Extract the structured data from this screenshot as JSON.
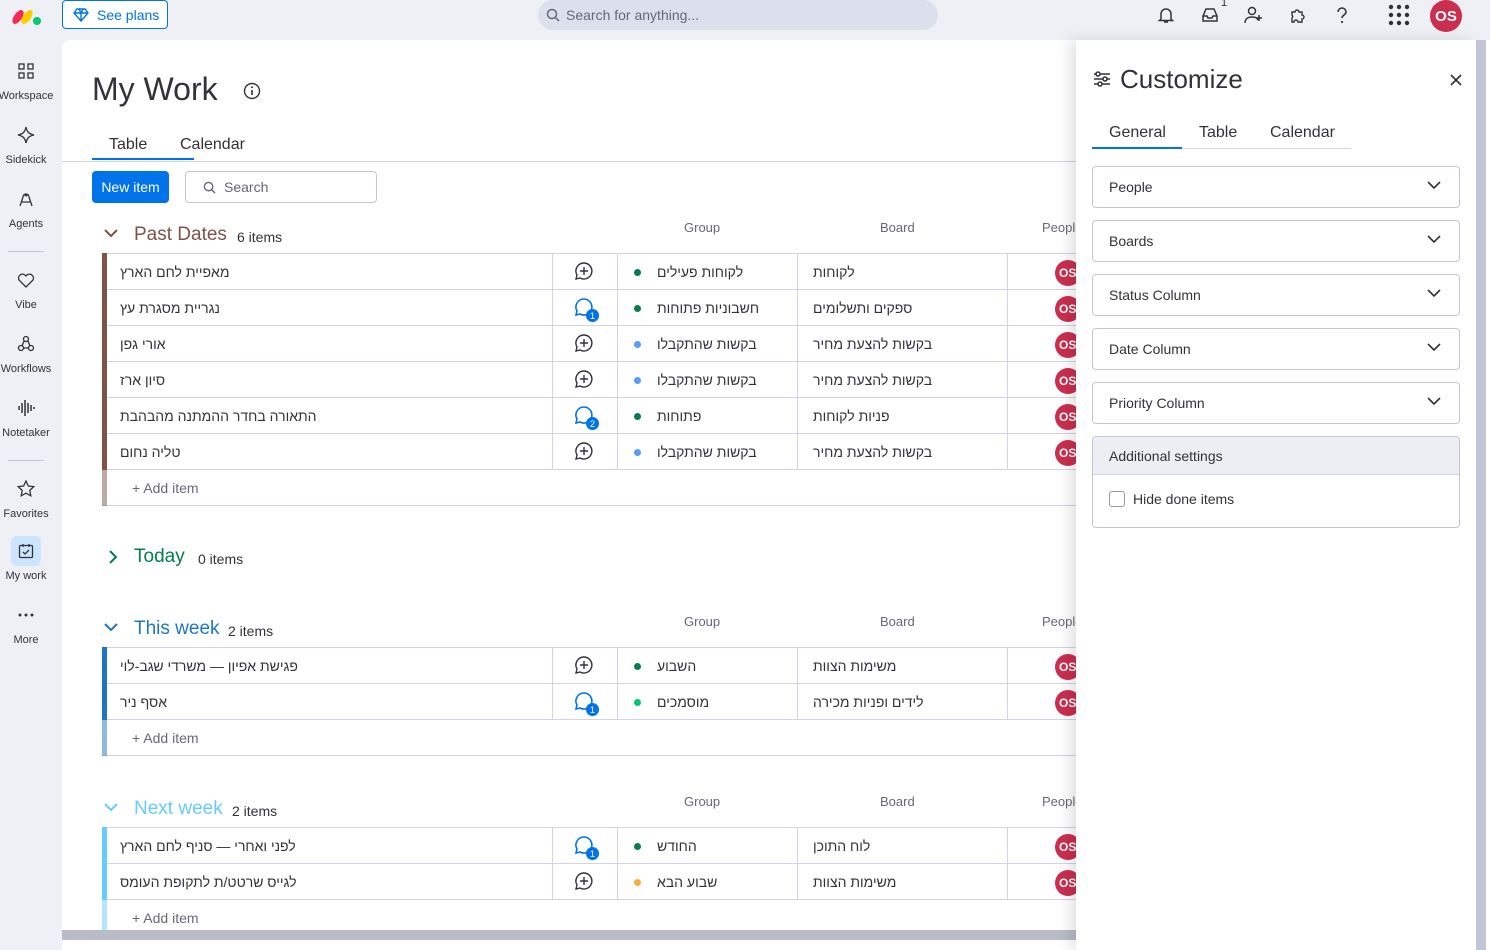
{
  "topbar": {
    "see_plans": "See plans",
    "search_placeholder": "Search for anything...",
    "inbox_count": "1",
    "avatar_initials": "OS"
  },
  "rail": {
    "items": [
      {
        "label": "Workspace",
        "icon": "grid-icon"
      },
      {
        "label": "Sidekick",
        "icon": "sparkle-icon"
      },
      {
        "label": "Agents",
        "icon": "agent-icon"
      },
      {
        "label": "Vibe",
        "icon": "heart-icon"
      },
      {
        "label": "Workflows",
        "icon": "workflow-icon"
      },
      {
        "label": "Notetaker",
        "icon": "waveform-icon"
      },
      {
        "label": "Favorites",
        "icon": "star-icon"
      },
      {
        "label": "My work",
        "icon": "calendar-check-icon"
      },
      {
        "label": "More",
        "icon": "dots-icon"
      }
    ]
  },
  "page": {
    "title": "My Work",
    "tabs": [
      "Table",
      "Calendar"
    ],
    "new_item": "New item",
    "search_placeholder": "Search"
  },
  "columns": {
    "group": "Group",
    "board": "Board",
    "people": "People"
  },
  "groups": [
    {
      "title": "Past Dates",
      "count": "6 items",
      "color": "#7f5347",
      "add_item": "+ Add item",
      "rows": [
        {
          "name": "מאפיית לחם הארץ",
          "group": "לקוחות פעילים",
          "board": "לקוחות",
          "dot": "#037f4c",
          "updates": ""
        },
        {
          "name": "נגריית מסגרת עץ",
          "group": "חשבוניות פתוחות",
          "board": "ספקים ותשלומים",
          "dot": "#037f4c",
          "updates": "1"
        },
        {
          "name": "אורי גפן",
          "group": "בקשות שהתקבלו",
          "board": "בקשות להצעת מחיר",
          "dot": "#579bfc",
          "updates": ""
        },
        {
          "name": "סיון ארז",
          "group": "בקשות שהתקבלו",
          "board": "בקשות להצעת מחיר",
          "dot": "#579bfc",
          "updates": ""
        },
        {
          "name": "התאורה בחדר ההמתנה מהבהבת",
          "group": "פתוחות",
          "board": "פניות לקוחות",
          "dot": "#037f4c",
          "updates": "2"
        },
        {
          "name": "טליה נחום",
          "group": "בקשות שהתקבלו",
          "board": "בקשות להצעת מחיר",
          "dot": "#579bfc",
          "updates": ""
        }
      ]
    },
    {
      "title": "Today",
      "count": "0 items",
      "color": "#037f4c",
      "collapsed": true,
      "rows": []
    },
    {
      "title": "This week",
      "count": "2 items",
      "color": "#1f76c2",
      "add_item": "+ Add item",
      "rows": [
        {
          "name": "פגישת אפיון — משרדי שגב-לוי",
          "group": "השבוע",
          "board": "משימות הצוות",
          "dot": "#037f4c",
          "updates": ""
        },
        {
          "name": "אסף ניר",
          "group": "מוסמכים",
          "board": "לידים ופניות מכירה",
          "dot": "#00c875",
          "updates": "1"
        }
      ]
    },
    {
      "title": "Next week",
      "count": "2 items",
      "color": "#66ccff",
      "add_item": "+ Add item",
      "rows": [
        {
          "name": "לפני ואחרי — סניף לחם הארץ",
          "group": "החודש",
          "board": "לוח התוכן",
          "dot": "#037f4c",
          "updates": "1"
        },
        {
          "name": "לגייס שרטט/ת לתקופת העומס",
          "group": "שבוע הבא",
          "board": "משימות הצוות",
          "dot": "#fdab3d",
          "updates": ""
        }
      ]
    }
  ],
  "row_avatar": "OS",
  "drawer": {
    "title": "Customize",
    "tabs": [
      "General",
      "Table",
      "Calendar"
    ],
    "dropdowns": [
      "People",
      "Boards",
      "Status Column",
      "Date Column",
      "Priority Column"
    ],
    "additional_settings": "Additional settings",
    "hide_done": "Hide done items"
  },
  "colors": {
    "accent": "#0073ea",
    "avatar": "#cc2e4f"
  }
}
